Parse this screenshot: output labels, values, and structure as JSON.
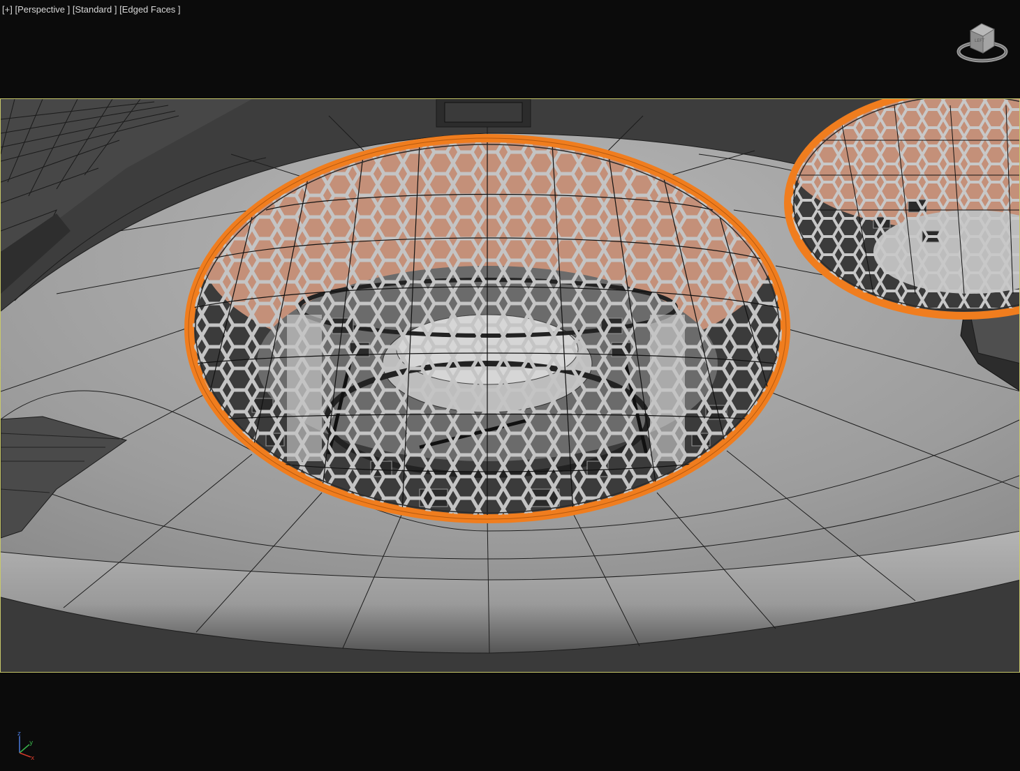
{
  "viewport": {
    "labels": {
      "plus": "[+]",
      "view": "[Perspective ]",
      "shading": "[Standard ]",
      "display": "[Edged Faces ]"
    },
    "frame_color": "#c8c86a",
    "selection_color": "#f07d1e"
  },
  "viewcube": {
    "icon": "viewcube-icon"
  },
  "axis_tripod": {
    "x": "x",
    "y": "y",
    "z": "z"
  }
}
